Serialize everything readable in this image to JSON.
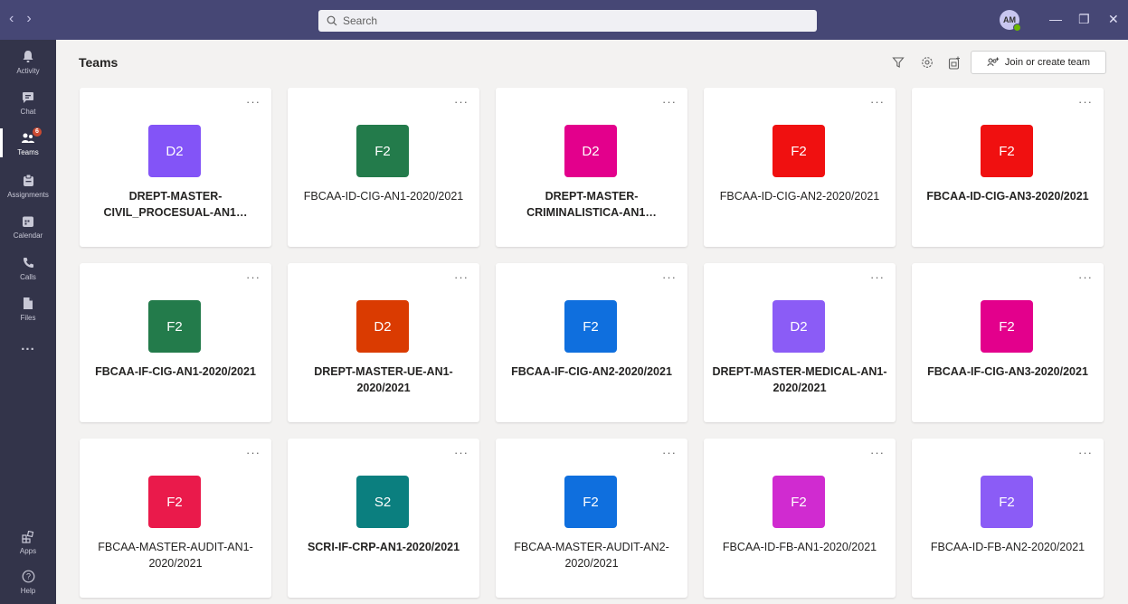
{
  "titlebar": {
    "back_icon": "chevron-left-icon",
    "forward_icon": "chevron-right-icon",
    "search_placeholder": "Search",
    "avatar_initials": "AM",
    "minimize": "—",
    "maximize": "❐",
    "close": "✕"
  },
  "rail": {
    "items": [
      {
        "label": "Activity",
        "icon": "bell-icon"
      },
      {
        "label": "Chat",
        "icon": "chat-icon"
      },
      {
        "label": "Teams",
        "icon": "teams-icon",
        "badge": "6"
      },
      {
        "label": "Assignments",
        "icon": "assignments-icon"
      },
      {
        "label": "Calendar",
        "icon": "calendar-icon"
      },
      {
        "label": "Calls",
        "icon": "phone-icon"
      },
      {
        "label": "Files",
        "icon": "file-icon"
      },
      {
        "label": "...",
        "icon": "more-icon"
      },
      {
        "label": "Apps",
        "icon": "apps-icon"
      },
      {
        "label": "Help",
        "icon": "help-icon"
      }
    ]
  },
  "header": {
    "title": "Teams",
    "join_label": "Join or create team"
  },
  "colors": {
    "titlebar": "#464775",
    "rail": "#33344a",
    "purple": "#8b5cf6",
    "green": "#237b4b",
    "magenta": "#e3008c",
    "red": "#e81123",
    "orange": "#da3b01",
    "blue": "#0078d4",
    "teal": "#038387"
  },
  "teams": [
    {
      "initials": "D2",
      "color": "#8354f7",
      "name": "DREPT-MASTER-CIVIL_PROCESUAL-AN1…",
      "bold": true
    },
    {
      "initials": "F2",
      "color": "#237b4b",
      "name": "FBCAA-ID-CIG-AN1-2020/2021",
      "bold": false
    },
    {
      "initials": "D2",
      "color": "#e3008c",
      "name": "DREPT-MASTER-CRIMINALISTICA-AN1…",
      "bold": true
    },
    {
      "initials": "F2",
      "color": "#f01010",
      "name": "FBCAA-ID-CIG-AN2-2020/2021",
      "bold": false
    },
    {
      "initials": "F2",
      "color": "#f01010",
      "name": "FBCAA-ID-CIG-AN3-2020/2021",
      "bold": true
    },
    {
      "initials": "F2",
      "color": "#237b4b",
      "name": "FBCAA-IF-CIG-AN1-2020/2021",
      "bold": true
    },
    {
      "initials": "D2",
      "color": "#da3b01",
      "name": "DREPT-MASTER-UE-AN1-2020/2021",
      "bold": true
    },
    {
      "initials": "F2",
      "color": "#0f6fde",
      "name": "FBCAA-IF-CIG-AN2-2020/2021",
      "bold": true
    },
    {
      "initials": "D2",
      "color": "#8b5cf6",
      "name": "DREPT-MASTER-MEDICAL-AN1-2020/2021",
      "bold": true
    },
    {
      "initials": "F2",
      "color": "#e3008c",
      "name": "FBCAA-IF-CIG-AN3-2020/2021",
      "bold": true
    },
    {
      "initials": "F2",
      "color": "#ea1a4b",
      "name": "FBCAA-MASTER-AUDIT-AN1-2020/2021",
      "bold": false
    },
    {
      "initials": "S2",
      "color": "#0b7f7f",
      "name": "SCRI-IF-CRP-AN1-2020/2021",
      "bold": true
    },
    {
      "initials": "F2",
      "color": "#0f6fde",
      "name": "FBCAA-MASTER-AUDIT-AN2-2020/2021",
      "bold": false
    },
    {
      "initials": "F2",
      "color": "#d02bd0",
      "name": "FBCAA-ID-FB-AN1-2020/2021",
      "bold": false
    },
    {
      "initials": "F2",
      "color": "#8b5cf6",
      "name": "FBCAA-ID-FB-AN2-2020/2021",
      "bold": false
    }
  ]
}
